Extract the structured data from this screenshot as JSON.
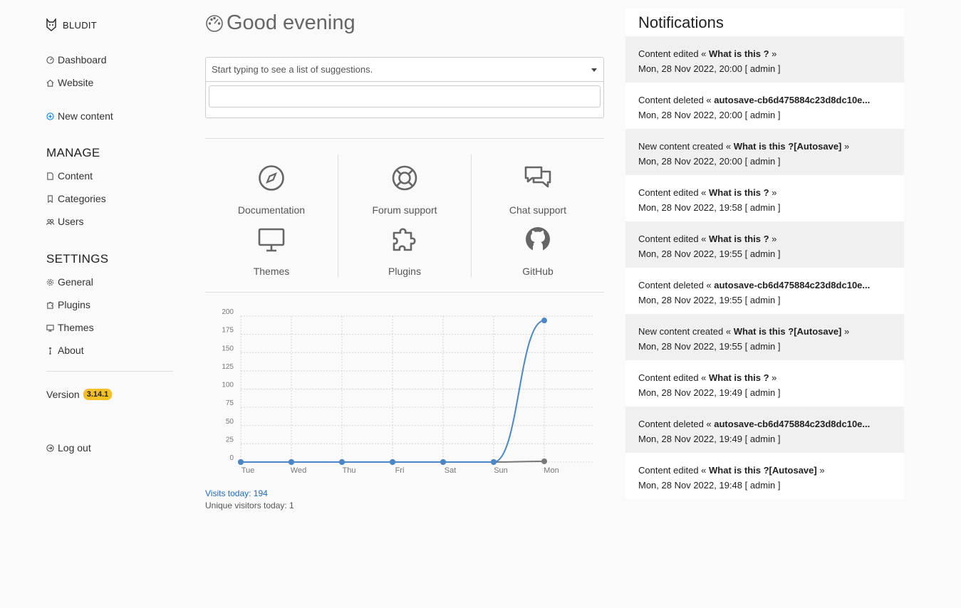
{
  "brand": {
    "name": "BLUDIT"
  },
  "sidebar": {
    "dashboard": "Dashboard",
    "website": "Website",
    "new_content": "New content",
    "manage_title": "MANAGE",
    "content": "Content",
    "categories": "Categories",
    "users": "Users",
    "settings_title": "SETTINGS",
    "general": "General",
    "plugins": "Plugins",
    "themes": "Themes",
    "about": "About",
    "version_label": "Version",
    "version": "3.14.1",
    "logout": "Log out"
  },
  "main": {
    "greeting": "Good evening",
    "search_placeholder": "Start typing to see a list of suggestions.",
    "quick_links": [
      {
        "label": "Documentation",
        "icon": "compass-icon"
      },
      {
        "label": "Forum support",
        "icon": "lifebuoy-icon"
      },
      {
        "label": "Chat support",
        "icon": "chat-icon"
      },
      {
        "label": "Themes",
        "icon": "monitor-icon"
      },
      {
        "label": "Plugins",
        "icon": "puzzle-icon"
      },
      {
        "label": "GitHub",
        "icon": "github-icon"
      }
    ],
    "visits_today": "Visits today: 194",
    "unique_today": "Unique visitors today: 1"
  },
  "chart_data": {
    "type": "line",
    "categories": [
      "Tue",
      "Wed",
      "Thu",
      "Fri",
      "Sat",
      "Sun",
      "Mon"
    ],
    "series": [
      {
        "values": [
          0,
          0,
          0,
          0,
          0,
          0,
          194
        ],
        "color": "#4a86c8"
      },
      {
        "values": [
          0,
          0,
          0,
          0,
          0,
          0,
          1
        ],
        "color": "#777777"
      }
    ],
    "yticks": [
      0,
      25,
      50,
      75,
      100,
      125,
      150,
      175,
      200
    ],
    "ylim": [
      0,
      200
    ],
    "grid": true
  },
  "notifications": {
    "title": "Notifications",
    "items": [
      {
        "action": "Content edited «",
        "target": "What is this ?",
        "end": " »",
        "date": "Mon, 28 Nov 2022, 20:00 [ admin ]"
      },
      {
        "action": "Content deleted «",
        "target": "autosave-cb6d475884c23d8dc10e...",
        "end": "",
        "date": "Mon, 28 Nov 2022, 20:00 [ admin ]"
      },
      {
        "action": "New content created «",
        "target": "What is this ?[Autosave]",
        "end": " »",
        "date": "Mon, 28 Nov 2022, 20:00 [ admin ]"
      },
      {
        "action": "Content edited «",
        "target": "What is this ?",
        "end": " »",
        "date": "Mon, 28 Nov 2022, 19:58 [ admin ]"
      },
      {
        "action": "Content edited «",
        "target": "What is this ?",
        "end": " »",
        "date": "Mon, 28 Nov 2022, 19:55 [ admin ]"
      },
      {
        "action": "Content deleted «",
        "target": "autosave-cb6d475884c23d8dc10e...",
        "end": "",
        "date": "Mon, 28 Nov 2022, 19:55 [ admin ]"
      },
      {
        "action": "New content created «",
        "target": "What is this ?[Autosave]",
        "end": " »",
        "date": "Mon, 28 Nov 2022, 19:55 [ admin ]"
      },
      {
        "action": "Content edited «",
        "target": "What is this ?",
        "end": " »",
        "date": "Mon, 28 Nov 2022, 19:49 [ admin ]"
      },
      {
        "action": "Content deleted «",
        "target": "autosave-cb6d475884c23d8dc10e...",
        "end": "",
        "date": "Mon, 28 Nov 2022, 19:49 [ admin ]"
      },
      {
        "action": "Content edited «",
        "target": "What is this ?[Autosave]",
        "end": " »",
        "date": "Mon, 28 Nov 2022, 19:48 [ admin ]"
      }
    ]
  }
}
